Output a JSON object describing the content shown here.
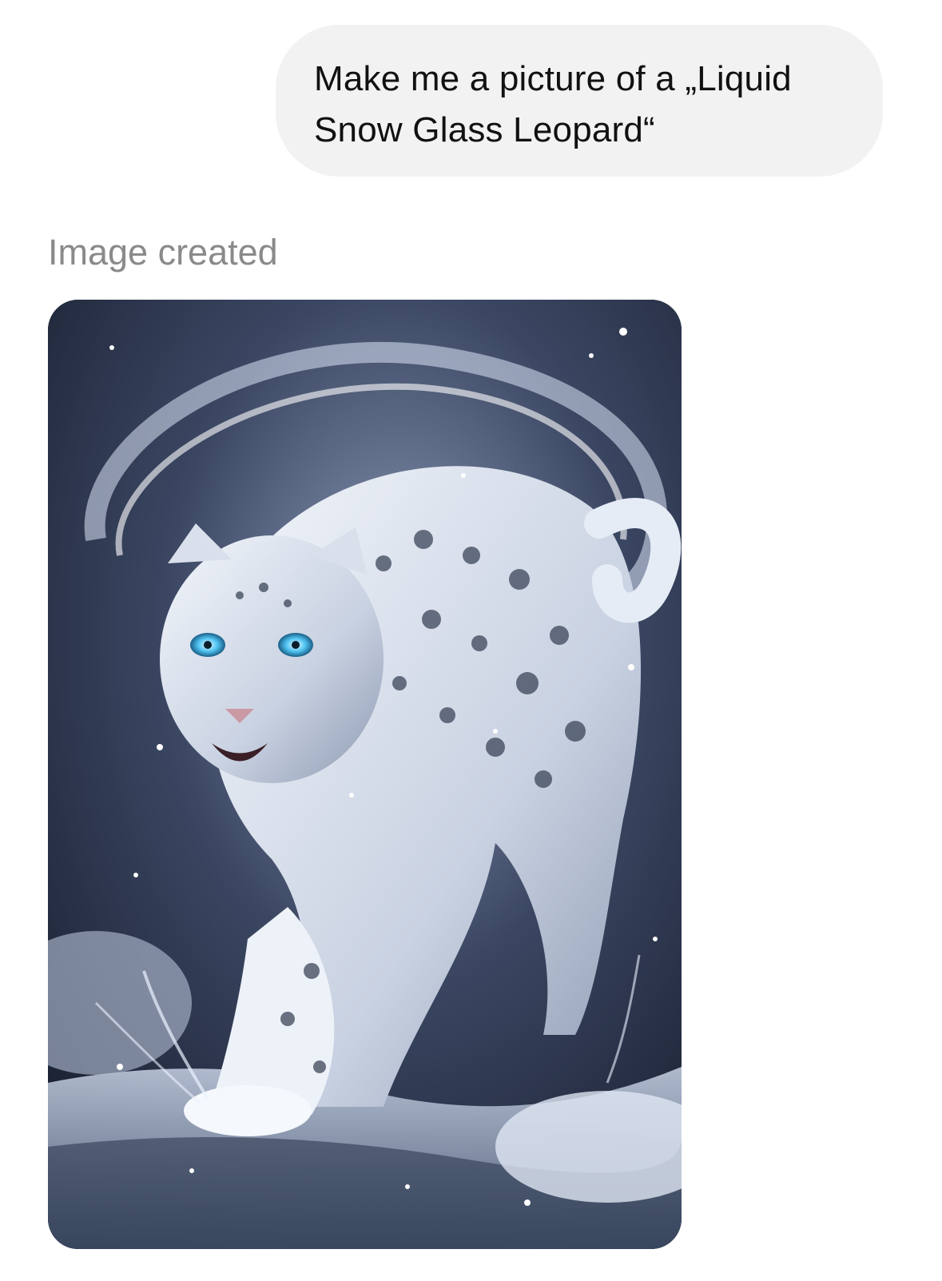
{
  "conversation": {
    "user_message": "Make me a picture of a „Liquid\nSnow Glass Leopard“",
    "status_label": "Image created"
  },
  "colors": {
    "bubble_background": "#f2f2f2",
    "status_text": "#8a8a8a",
    "message_text": "#111111"
  },
  "generated_image": {
    "icon": "snow-leopard-image",
    "subject": "snow-leopard",
    "alt": ""
  }
}
